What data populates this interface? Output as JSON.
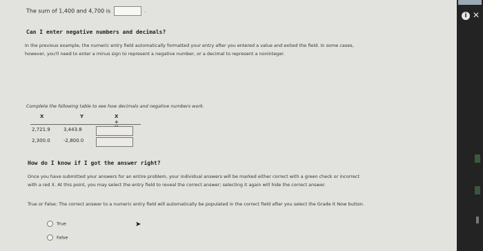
{
  "sum_question": {
    "prefix": "The sum of 1,400 and 4,700 is",
    "input_value": "",
    "suffix": "."
  },
  "section1": {
    "heading": "Can I enter negative numbers and decimals?",
    "line1": "In the previous example, the numeric entry field automatically formatted your entry after you entered a value and exited the field. In some cases,",
    "line2": "however, you'll need to enter a minus sign to represent a negative number, or a decimal to represent a noninteger."
  },
  "table": {
    "prompt": "Complete the following table to see how decimals and negative numbers work.",
    "headers": [
      "X",
      "Y",
      "X + Y"
    ],
    "rows": [
      {
        "x": "2,721.9",
        "y": "3,443.8",
        "sum": ""
      },
      {
        "x": "2,300.0",
        "y": "-2,800.0",
        "sum": ""
      }
    ]
  },
  "section2": {
    "heading": "How do I know if I got the answer right?",
    "line1": "Once you have submitted your answers for an entire problem, your individual answers will be marked either correct with a green check or incorrect",
    "line2": "with a red X. At this point, you may select the entry field to reveal the correct answer; selecting it again will hide the correct answer."
  },
  "question": {
    "text": "True or False: The correct answer to a numeric entry field will automatically be populated in the correct field after you select the Grade It Now button.",
    "options": [
      "True",
      "False"
    ]
  },
  "sidebar": {
    "info_icon": "info-icon",
    "close_icon": "close-icon",
    "info_glyph": "i",
    "close_glyph": "✕"
  },
  "colors": {
    "page": "#e2e2de",
    "sidebar": "#232323"
  }
}
